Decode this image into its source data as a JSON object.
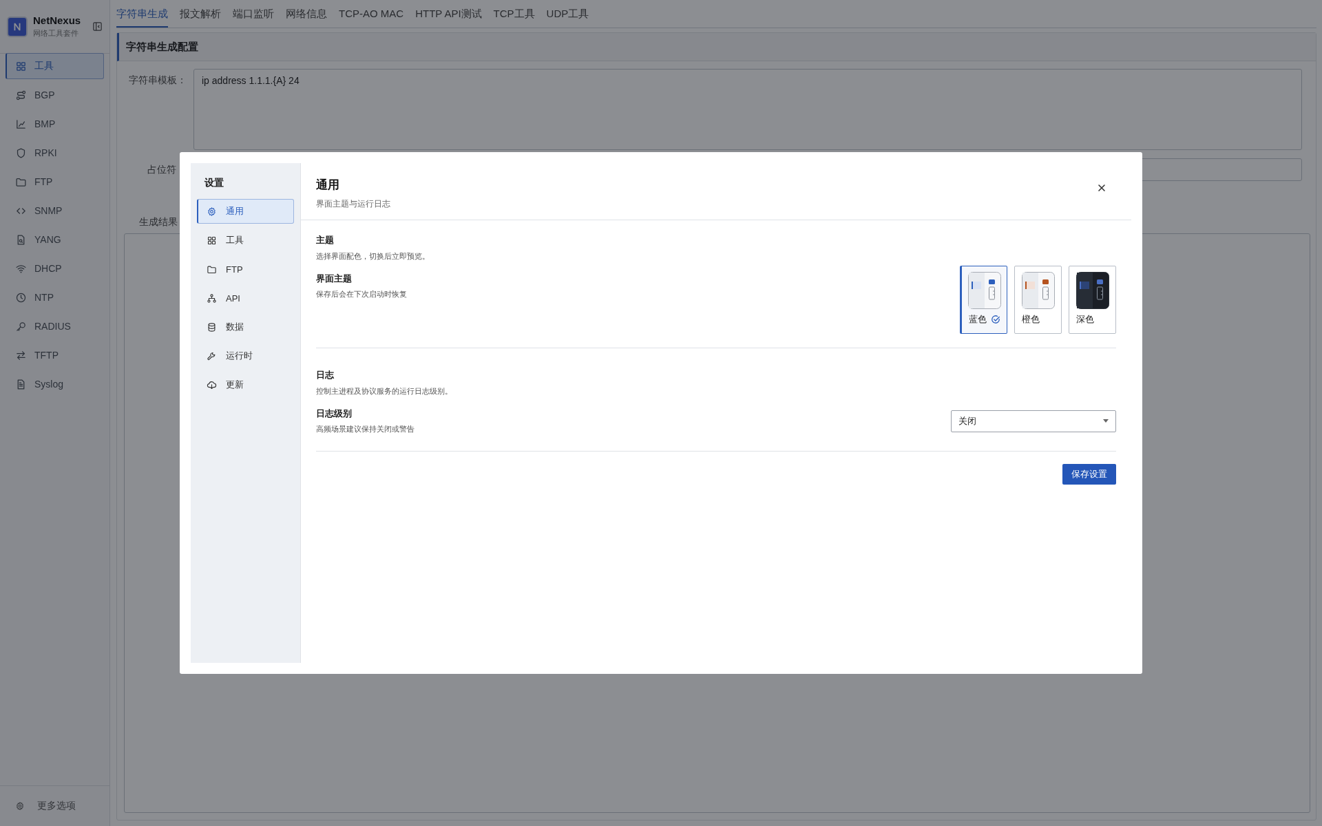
{
  "app": {
    "name": "NetNexus",
    "subtitle": "网络工具套件"
  },
  "sidebar": {
    "items": [
      {
        "label": "工具",
        "selected": true
      },
      {
        "label": "BGP",
        "selected": false
      },
      {
        "label": "BMP",
        "selected": false
      },
      {
        "label": "RPKI",
        "selected": false
      },
      {
        "label": "FTP",
        "selected": false
      },
      {
        "label": "SNMP",
        "selected": false
      },
      {
        "label": "YANG",
        "selected": false
      },
      {
        "label": "DHCP",
        "selected": false
      },
      {
        "label": "NTP",
        "selected": false
      },
      {
        "label": "RADIUS",
        "selected": false
      },
      {
        "label": "TFTP",
        "selected": false
      },
      {
        "label": "Syslog",
        "selected": false
      }
    ],
    "footer": "更多选项"
  },
  "tabs": [
    {
      "label": "字符串生成",
      "selected": true
    },
    {
      "label": "报文解析",
      "selected": false
    },
    {
      "label": "端口监听",
      "selected": false
    },
    {
      "label": "网络信息",
      "selected": false
    },
    {
      "label": "TCP-AO MAC",
      "selected": false
    },
    {
      "label": "HTTP API测试",
      "selected": false
    },
    {
      "label": "TCP工具",
      "selected": false
    },
    {
      "label": "UDP工具",
      "selected": false
    }
  ],
  "panel": {
    "title": "字符串生成配置",
    "template_label": "字符串模板：",
    "template_value": "ip address 1.1.1.{A} 24",
    "placeholder_label": "占位符",
    "result_label": "生成结果"
  },
  "dialog": {
    "nav_title": "设置",
    "nav": [
      {
        "label": "通用",
        "selected": true
      },
      {
        "label": "工具",
        "selected": false
      },
      {
        "label": "FTP",
        "selected": false
      },
      {
        "label": "API",
        "selected": false
      },
      {
        "label": "数据",
        "selected": false
      },
      {
        "label": "运行时",
        "selected": false
      },
      {
        "label": "更新",
        "selected": false
      }
    ],
    "title": "通用",
    "subtitle": "界面主题与运行日志",
    "theme_section": {
      "title": "主题",
      "description": "选择界面配色，切换后立即预览。",
      "row_label": "界面主题",
      "row_description": "保存后会在下次启动时恢复",
      "themes": [
        {
          "label": "蓝色",
          "kind": "light",
          "color": "#2c5fbd",
          "selected": true
        },
        {
          "label": "橙色",
          "kind": "light",
          "color": "#b5531f",
          "selected": false
        },
        {
          "label": "深色",
          "kind": "dark",
          "color": "#4a6fc4",
          "selected": false
        }
      ]
    },
    "log_section": {
      "title": "日志",
      "description": "控制主进程及协议服务的运行日志级别。",
      "row_label": "日志级别",
      "row_description": "高频场景建议保持关闭或警告",
      "value": "关闭"
    },
    "save_button": "保存设置"
  }
}
